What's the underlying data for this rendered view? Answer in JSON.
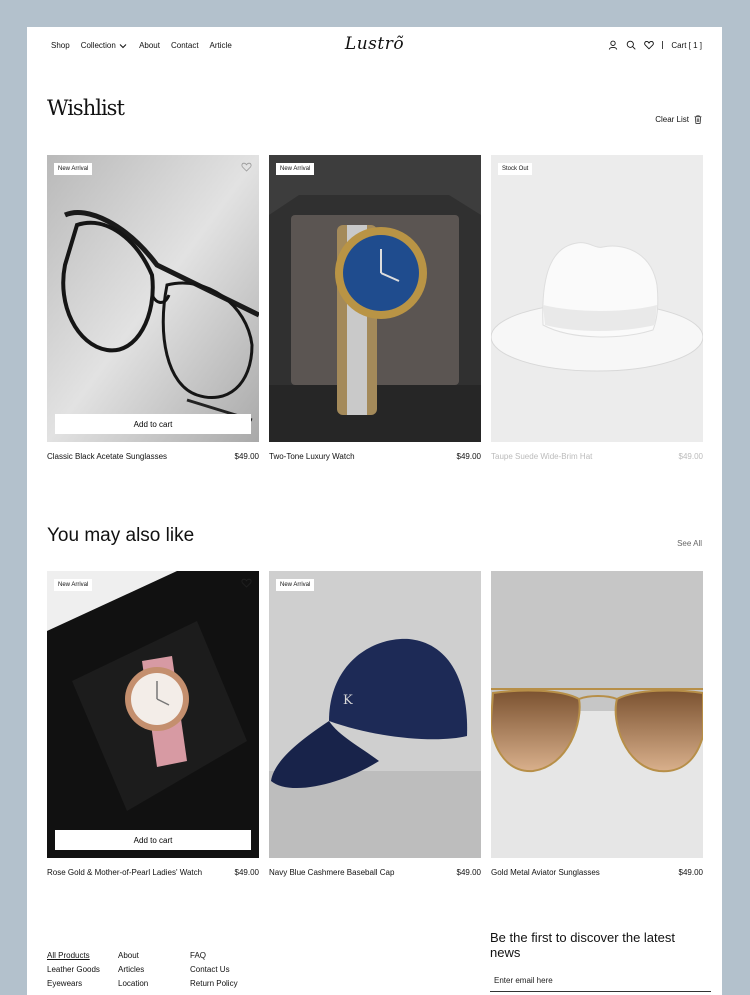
{
  "header": {
    "nav": [
      "Shop",
      "Collection",
      "About",
      "Contact",
      "Article"
    ],
    "logo": "Lustrõ",
    "cart": "Cart [ 1 ]"
  },
  "wishlist": {
    "title": "Wishlist",
    "clear_label": "Clear List",
    "add_to_cart": "Add to cart",
    "items": [
      {
        "badge": "New Arrival",
        "name": "Classic Black Acetate Sunglasses",
        "price": "$49.00"
      },
      {
        "badge": "New Arrival",
        "name": "Two-Tone Luxury Watch",
        "price": "$49.00"
      },
      {
        "badge": "Stock Out",
        "name": "Taupe Suede Wide-Brim Hat",
        "price": "$49.00"
      }
    ]
  },
  "also_like": {
    "title": "You may also like",
    "see_all": "See All",
    "add_to_cart": "Add to cart",
    "items": [
      {
        "badge": "New Arrival",
        "name": "Rose Gold & Mother-of-Pearl Ladies' Watch",
        "price": "$49.00"
      },
      {
        "badge": "New Arrival",
        "name": "Navy Blue Cashmere Baseball Cap",
        "price": "$49.00"
      },
      {
        "badge": "",
        "name": "Gold Metal Aviator Sunglasses",
        "price": "$49.00"
      }
    ]
  },
  "footer": {
    "col1": [
      "All Products",
      "Leather Goods",
      "Eyewears"
    ],
    "col2": [
      "About",
      "Articles",
      "Location"
    ],
    "col3": [
      "FAQ",
      "Contact Us",
      "Return Policy"
    ],
    "newsletter_title": "Be the first to discover the latest news",
    "email_placeholder": "Enter email here"
  },
  "colors": {
    "background": "#b3c1cc",
    "page": "#ffffff",
    "text": "#111111"
  }
}
